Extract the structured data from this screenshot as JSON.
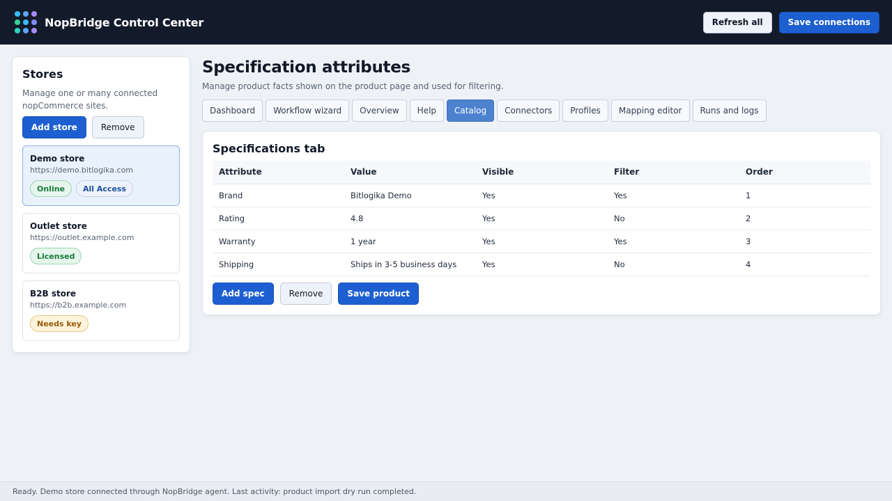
{
  "app": {
    "title": "NopBridge Control Center",
    "logo_colors": [
      "#38bdf8",
      "#60a5fa",
      "#a78bfa",
      "#34d399",
      "#38bdf8",
      "#818cf8",
      "#2dd4bf",
      "#60a5fa",
      "#a78bfa"
    ]
  },
  "header": {
    "refresh_label": "Refresh all",
    "save_label": "Save connections"
  },
  "sidebar": {
    "title": "Stores",
    "description": "Manage one or many connected nopCommerce sites.",
    "add_label": "Add store",
    "remove_label": "Remove",
    "stores": [
      {
        "name": "Demo store",
        "url": "https://demo.bitlogika.com",
        "badges": [
          {
            "label": "Online",
            "tone": "green"
          },
          {
            "label": "All Access",
            "tone": "blue"
          }
        ],
        "selected": true
      },
      {
        "name": "Outlet store",
        "url": "https://outlet.example.com",
        "badges": [
          {
            "label": "Licensed",
            "tone": "green"
          }
        ],
        "selected": false
      },
      {
        "name": "B2B store",
        "url": "https://b2b.example.com",
        "badges": [
          {
            "label": "Needs key",
            "tone": "amber"
          }
        ],
        "selected": false
      }
    ]
  },
  "main": {
    "title": "Specification attributes",
    "subtitle": "Manage product facts shown on the product page and used for filtering.",
    "tabs": [
      {
        "label": "Dashboard",
        "active": false
      },
      {
        "label": "Workflow wizard",
        "active": false
      },
      {
        "label": "Overview",
        "active": false
      },
      {
        "label": "Help",
        "active": false
      },
      {
        "label": "Catalog",
        "active": true
      },
      {
        "label": "Connectors",
        "active": false
      },
      {
        "label": "Profiles",
        "active": false
      },
      {
        "label": "Mapping editor",
        "active": false
      },
      {
        "label": "Runs and logs",
        "active": false
      }
    ],
    "panel": {
      "title": "Specifications tab",
      "columns": [
        "Attribute",
        "Value",
        "Visible",
        "Filter",
        "Order"
      ],
      "rows": [
        [
          "Brand",
          "Bitlogika Demo",
          "Yes",
          "Yes",
          "1"
        ],
        [
          "Rating",
          "4.8",
          "Yes",
          "No",
          "2"
        ],
        [
          "Warranty",
          "1 year",
          "Yes",
          "Yes",
          "3"
        ],
        [
          "Shipping",
          "Ships in 3-5 business days",
          "Yes",
          "No",
          "4"
        ]
      ],
      "add_label": "Add spec",
      "remove_label": "Remove",
      "save_label": "Save product"
    }
  },
  "status": {
    "text": "Ready. Demo store connected through NopBridge agent. Last activity: product import dry run completed."
  }
}
